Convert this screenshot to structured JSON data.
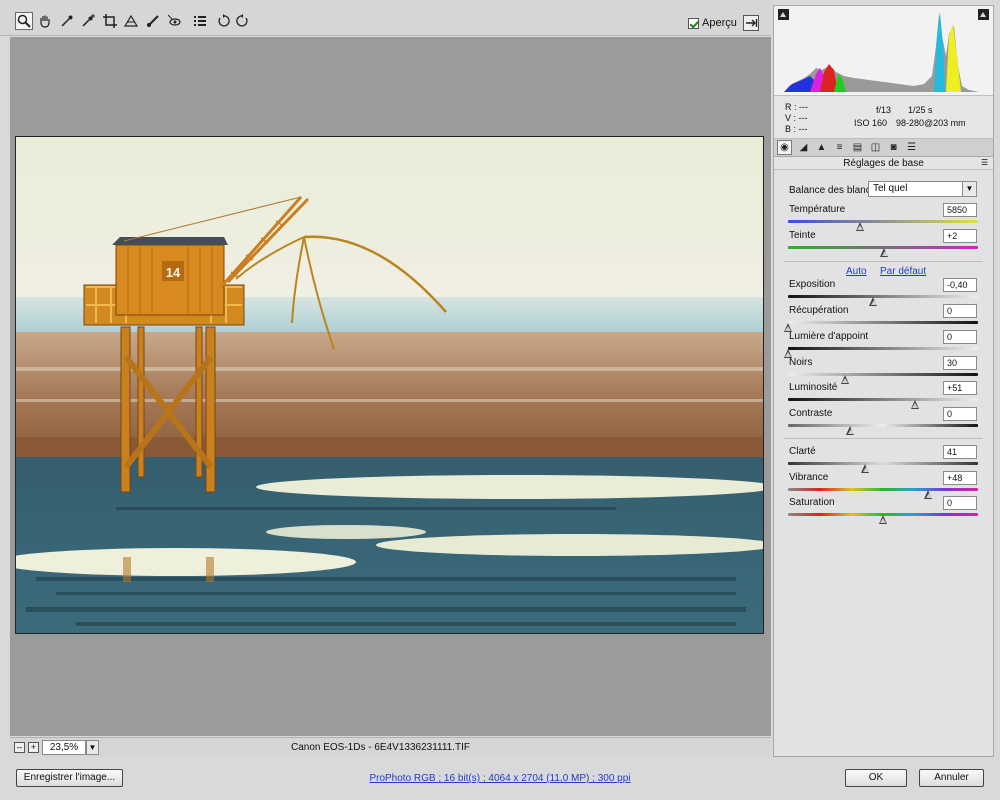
{
  "toolbar": {
    "tools": [
      {
        "name": "zoom-tool",
        "icon": "zoom-icon"
      },
      {
        "name": "hand-tool",
        "icon": "hand-icon"
      },
      {
        "name": "white-balance-tool",
        "icon": "eyedropper-icon"
      },
      {
        "name": "color-sampler-tool",
        "icon": "color-sampler-icon"
      },
      {
        "name": "crop-tool",
        "icon": "crop-icon"
      },
      {
        "name": "straighten-tool",
        "icon": "straighten-icon"
      },
      {
        "name": "retouch-tool",
        "icon": "brush-icon"
      },
      {
        "name": "red-eye-tool",
        "icon": "red-eye-icon"
      },
      {
        "name": "preferences-tool",
        "icon": "list-icon"
      },
      {
        "name": "rotate-left-tool",
        "icon": "rotate-left-icon"
      },
      {
        "name": "rotate-right-tool",
        "icon": "rotate-right-icon"
      }
    ],
    "preview_label": "Aperçu",
    "preview_checked": true
  },
  "status": {
    "zoom_value": "23,5%",
    "camera": "Canon EOS-1Ds",
    "separator": "-",
    "filename": "6E4V1336231111.TIF"
  },
  "readouts": {
    "r": "R :  ---",
    "g": "V :  ---",
    "b": "B :  ---",
    "aperture": "f/13",
    "shutter": "1/25 s",
    "iso": "ISO 160",
    "lens": "98-280@203 mm"
  },
  "panel": {
    "section_title": "Réglages de base",
    "white_balance_label": "Balance des blancs :",
    "white_balance_value": "Tel quel",
    "auto_link": "Auto",
    "default_link": "Par défaut",
    "controls": {
      "temperature": {
        "label": "Température",
        "value": "5850",
        "level": 0.38
      },
      "tint": {
        "label": "Teinte",
        "value": "+2",
        "level": 0.51
      },
      "exposure": {
        "label": "Exposition",
        "value": "-0,40",
        "level": 0.45
      },
      "recovery": {
        "label": "Récupération",
        "value": "0",
        "level": 0.0
      },
      "fill_light": {
        "label": "Lumière d'appoint",
        "value": "0",
        "level": 0.0
      },
      "blacks": {
        "label": "Noirs",
        "value": "30",
        "level": 0.3
      },
      "brightness": {
        "label": "Luminosité",
        "value": "+51",
        "level": 0.67
      },
      "contrast": {
        "label": "Contraste",
        "value": "0",
        "level": 0.33
      },
      "clarity": {
        "label": "Clarté",
        "value": "41",
        "level": 0.41
      },
      "vibrance": {
        "label": "Vibrance",
        "value": "+48",
        "level": 0.74
      },
      "saturation": {
        "label": "Saturation",
        "value": "0",
        "level": 0.5
      }
    }
  },
  "footer": {
    "save_label": "Enregistrer l'image...",
    "workflow_info": "ProPhoto RGB ; 16 bit(s) ; 4064 x 2704 (11,0 MP) ; 300 ppi",
    "ok_label": "OK",
    "cancel_label": "Annuler"
  },
  "photo": {
    "hut_number": "14"
  }
}
